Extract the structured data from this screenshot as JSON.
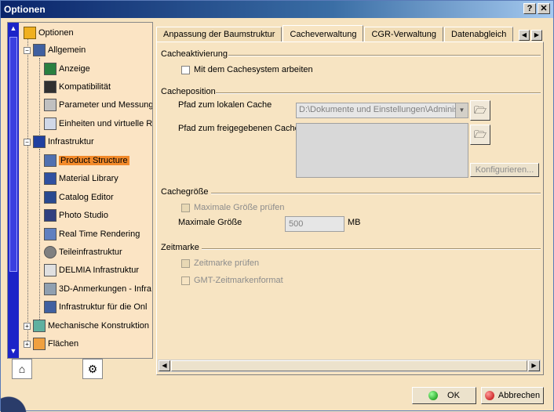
{
  "window": {
    "title": "Optionen",
    "help": "?",
    "close": "✕"
  },
  "tree": {
    "root": "Optionen",
    "items": [
      {
        "label": "Allgemein",
        "level": 1
      },
      {
        "label": "Anzeige",
        "level": 2
      },
      {
        "label": "Kompatibilität",
        "level": 2
      },
      {
        "label": "Parameter und Messunge",
        "level": 2
      },
      {
        "label": "Einheiten und virtuelle R",
        "level": 2
      },
      {
        "label": "Infrastruktur",
        "level": 1
      },
      {
        "label": "Product Structure",
        "level": 2,
        "selected": true
      },
      {
        "label": "Material Library",
        "level": 2
      },
      {
        "label": "Catalog Editor",
        "level": 2
      },
      {
        "label": "Photo Studio",
        "level": 2
      },
      {
        "label": "Real Time Rendering",
        "level": 2
      },
      {
        "label": "Teileinfrastruktur",
        "level": 2
      },
      {
        "label": "DELMIA Infrastruktur",
        "level": 2
      },
      {
        "label": "3D-Anmerkungen - Infra",
        "level": 2
      },
      {
        "label": "Infrastruktur für die Onl",
        "level": 2
      },
      {
        "label": "Mechanische Konstruktion",
        "level": 1
      },
      {
        "label": "Flächen",
        "level": 1
      }
    ]
  },
  "tabs": [
    {
      "label": "Anpassung der Baumstruktur",
      "active": false
    },
    {
      "label": "Cacheverwaltung",
      "active": true
    },
    {
      "label": "CGR-Verwaltung",
      "active": false
    },
    {
      "label": "Datenabgleich",
      "active": false
    }
  ],
  "cacheaktivierung": {
    "title": "Cacheaktivierung",
    "checkbox": "Mit dem Cachesystem arbeiten"
  },
  "cacheposition": {
    "title": "Cacheposition",
    "local_label": "Pfad zum lokalen Cache",
    "local_value": "D:\\Dokumente und Einstellungen\\Administ",
    "shared_label": "Pfad zum freigegebenen Cache",
    "configure": "Konfigurieren..."
  },
  "cachegroesse": {
    "title": "Cachegröße",
    "checkbox": "Maximale Größe prüfen",
    "max_label": "Maximale Größe",
    "max_value": "500",
    "unit": "MB"
  },
  "zeitmarke": {
    "title": "Zeitmarke",
    "checkbox1": "Zeitmarke prüfen",
    "checkbox2": "GMT-Zeitmarkenformat"
  },
  "buttons": {
    "ok": "OK",
    "cancel": "Abbrechen"
  }
}
